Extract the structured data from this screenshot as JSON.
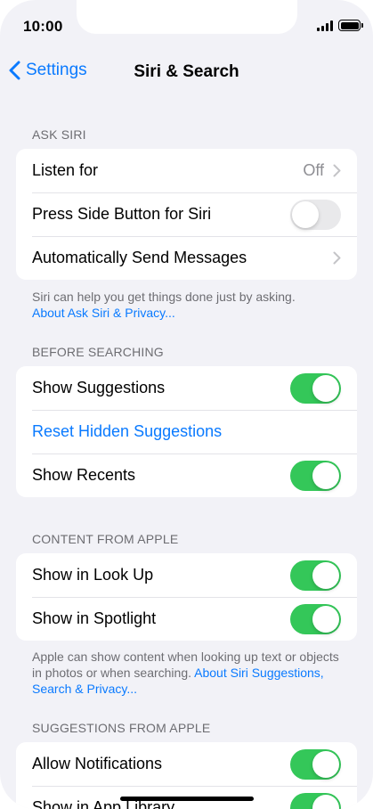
{
  "status": {
    "time": "10:00"
  },
  "nav": {
    "back_label": "Settings",
    "title": "Siri & Search"
  },
  "sections": {
    "ask_siri": {
      "header": "ASK SIRI",
      "rows": {
        "listen_for": {
          "label": "Listen for",
          "value": "Off"
        },
        "side_button": {
          "label": "Press Side Button for Siri",
          "toggle": false
        },
        "auto_send": {
          "label": "Automatically Send Messages"
        }
      },
      "footer": {
        "text": "Siri can help you get things done just by asking.",
        "link": "About Ask Siri & Privacy..."
      }
    },
    "before_searching": {
      "header": "BEFORE SEARCHING",
      "rows": {
        "show_suggestions": {
          "label": "Show Suggestions",
          "toggle": true
        },
        "reset_hidden": {
          "label": "Reset Hidden Suggestions"
        },
        "show_recents": {
          "label": "Show Recents",
          "toggle": true
        }
      }
    },
    "content_from_apple": {
      "header": "CONTENT FROM APPLE",
      "rows": {
        "look_up": {
          "label": "Show in Look Up",
          "toggle": true
        },
        "spotlight": {
          "label": "Show in Spotlight",
          "toggle": true
        }
      },
      "footer": {
        "text": "Apple can show content when looking up text or objects in photos or when searching.",
        "link": "About Siri Suggestions, Search & Privacy..."
      }
    },
    "suggestions_from_apple": {
      "header": "SUGGESTIONS FROM APPLE",
      "rows": {
        "notifications": {
          "label": "Allow Notifications",
          "toggle": true
        },
        "app_library": {
          "label": "Show in App Library",
          "toggle": true
        }
      }
    }
  },
  "colors": {
    "accent": "#0a7aff",
    "toggle_on": "#34c759",
    "background": "#f2f2f7"
  }
}
